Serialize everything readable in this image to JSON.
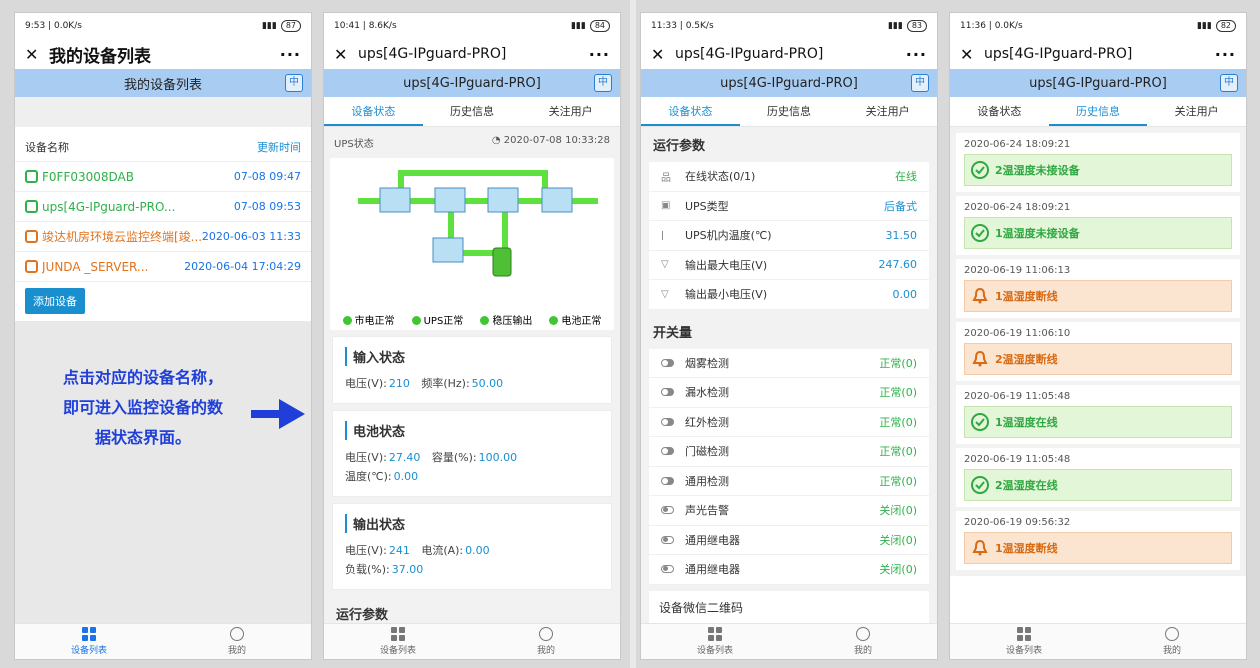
{
  "panel1": {
    "status": {
      "time": "9:53",
      "net": "0.0K/s",
      "battery": "87"
    },
    "title": "我的设备列表",
    "bar_title": "我的设备列表",
    "zh_button": "中",
    "header": {
      "name_col": "设备名称",
      "time_col": "更新时间"
    },
    "devices": [
      {
        "name": "F0FF03008DAB",
        "time": "07-08 09:47",
        "online": true
      },
      {
        "name": "ups[4G-IPguard-PRO...",
        "time": "07-08 09:53",
        "online": true
      },
      {
        "name": "竣达机房环境云监控终端[竣...",
        "time": "2020-06-03 11:33",
        "online": false
      },
      {
        "name": "JUNDA _SERVER...",
        "time": "2020-06-04 17:04:29",
        "online": false
      }
    ],
    "add_button": "添加设备",
    "note_lines": [
      "点击对应的设备名称，",
      "即可进入监控设备的数",
      "据状态界面。"
    ],
    "colors": {
      "note": "#1f3fd8",
      "arrow": "#1f3fd8"
    }
  },
  "panel2": {
    "status": {
      "time": "10:41",
      "net": "8.6K/s",
      "battery": "84"
    },
    "title": "ups[4G-IPguard-PRO]",
    "bar_title": "ups[4G-IPguard-PRO]",
    "zh_button": "中",
    "tabs": [
      "设备状态",
      "历史信息",
      "关注用户"
    ],
    "ups_label": "UPS状态",
    "ups_time": "2020-07-08 10:33:28",
    "legend": [
      "市电正常",
      "UPS正常",
      "稳压输出",
      "电池正常"
    ],
    "input": {
      "title": "输入状态",
      "voltage_label": "电压(V):",
      "voltage": "210",
      "freq_label": "频率(Hz):",
      "freq": "50.00"
    },
    "battery": {
      "title": "电池状态",
      "voltage_label": "电压(V):",
      "voltage": "27.40",
      "cap_label": "容量(%):",
      "cap": "100.00",
      "temp_label": "温度(℃):",
      "temp": "0.00"
    },
    "output": {
      "title": "输出状态",
      "voltage_label": "电压(V):",
      "voltage": "241",
      "current_label": "电流(A):",
      "current": "0.00",
      "load_label": "负载(%):",
      "load": "37.00"
    },
    "run_title": "运行参数"
  },
  "panel3": {
    "status": {
      "time": "11:33",
      "net": "0.5K/s",
      "battery": "83"
    },
    "title": "ups[4G-IPguard-PRO]",
    "bar_title": "ups[4G-IPguard-PRO]",
    "zh_button": "中",
    "tabs": [
      "设备状态",
      "历史信息",
      "关注用户"
    ],
    "run_title": "运行参数",
    "params": [
      {
        "label": "在线状态(0/1)",
        "value": "在线",
        "icon": "network-icon"
      },
      {
        "label": "UPS类型",
        "value": "后备式",
        "icon": "ups-icon"
      },
      {
        "label": "UPS机内温度(℃)",
        "value": "31.50",
        "icon": "thermometer-icon"
      },
      {
        "label": "输出最大电压(V)",
        "value": "247.60",
        "icon": "voltage-icon"
      },
      {
        "label": "输出最小电压(V)",
        "value": "0.00",
        "icon": "voltage-icon"
      }
    ],
    "switch_title": "开关量",
    "switches": [
      {
        "label": "烟雾检测",
        "value": "正常(0)",
        "on": true
      },
      {
        "label": "漏水检测",
        "value": "正常(0)",
        "on": true
      },
      {
        "label": "红外检测",
        "value": "正常(0)",
        "on": true
      },
      {
        "label": "门磁检测",
        "value": "正常(0)",
        "on": true
      },
      {
        "label": "通用检测",
        "value": "正常(0)",
        "on": true
      },
      {
        "label": "声光告警",
        "value": "关闭(0)",
        "on": false
      },
      {
        "label": "通用继电器",
        "value": "关闭(0)",
        "on": false
      },
      {
        "label": "通用继电器",
        "value": "关闭(0)",
        "on": false
      }
    ],
    "qr_label": "设备微信二维码"
  },
  "panel4": {
    "status": {
      "time": "11:36",
      "net": "0.0K/s",
      "battery": "82"
    },
    "title": "ups[4G-IPguard-PRO]",
    "bar_title": "ups[4G-IPguard-PRO]",
    "zh_button": "中",
    "tabs": [
      "设备状态",
      "历史信息",
      "关注用户"
    ],
    "history": [
      {
        "time": "2020-06-24 18:09:21",
        "msg": "2温湿度未接设备",
        "type": "ok"
      },
      {
        "time": "2020-06-24 18:09:21",
        "msg": "1温湿度未接设备",
        "type": "ok"
      },
      {
        "time": "2020-06-19 11:06:13",
        "msg": "1温湿度断线",
        "type": "warn"
      },
      {
        "time": "2020-06-19 11:06:10",
        "msg": "2温湿度断线",
        "type": "warn"
      },
      {
        "time": "2020-06-19 11:05:48",
        "msg": "1温湿度在线",
        "type": "ok"
      },
      {
        "time": "2020-06-19 11:05:48",
        "msg": "2温湿度在线",
        "type": "ok"
      },
      {
        "time": "2020-06-19 09:56:32",
        "msg": "1温湿度断线",
        "type": "warn"
      }
    ]
  },
  "nav": {
    "devices": "设备列表",
    "me": "我的"
  }
}
